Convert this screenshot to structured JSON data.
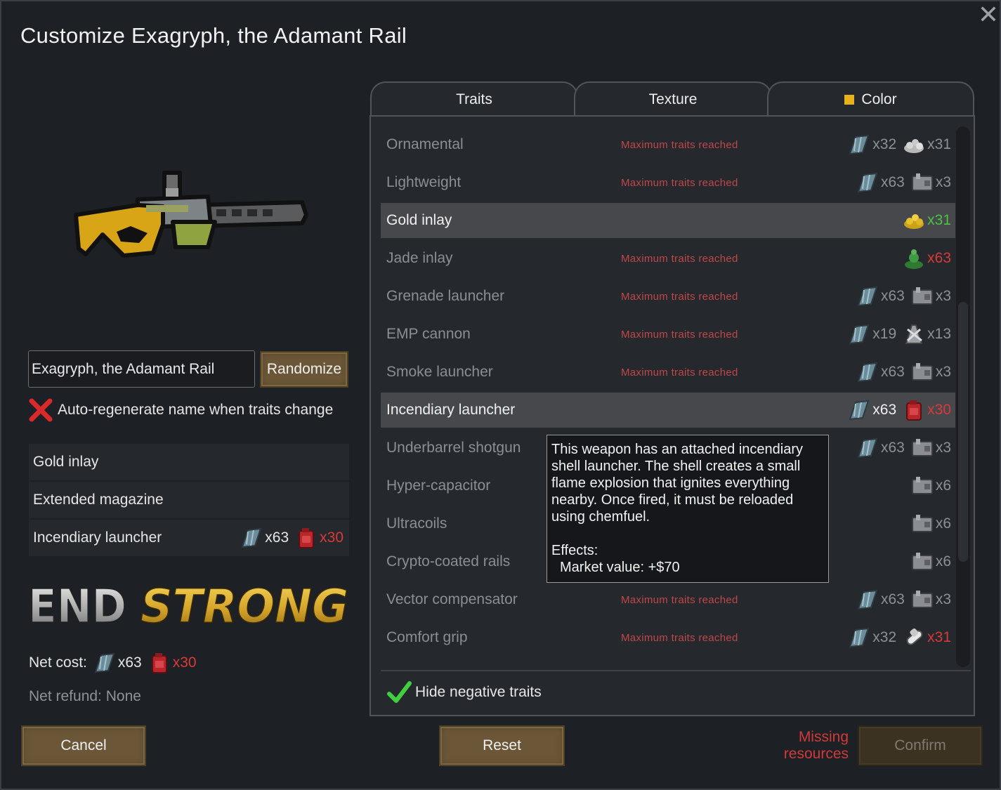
{
  "dialog": {
    "title": "Customize Exagryph, the Adamant Rail",
    "close_icon": "close-icon"
  },
  "name_field": {
    "value": "Exagryph, the Adamant Rail"
  },
  "buttons": {
    "randomize": "Randomize",
    "cancel": "Cancel",
    "reset": "Reset",
    "confirm": "Confirm"
  },
  "autoregen": {
    "label": "Auto-regenerate name when traits change",
    "checked": false
  },
  "selected_traits": [
    {
      "name": "Gold inlay"
    },
    {
      "name": "Extended magazine"
    },
    {
      "name": "Incendiary launcher",
      "cost1": "x63",
      "cost2": "x30"
    }
  ],
  "logo_text": "END STRONG",
  "net_cost": {
    "label": "Net cost:",
    "cost1": "x63",
    "cost2": "x30"
  },
  "net_refund": "Net refund: None",
  "missing": {
    "line1": "Missing",
    "line2": "resources"
  },
  "tabs": [
    {
      "label": "Traits"
    },
    {
      "label": "Texture"
    },
    {
      "label": "Color"
    }
  ],
  "colors": {
    "selected_color": "#e7b21a",
    "error_red": "#d83a3a",
    "ok_green": "#49c34a"
  },
  "traits": [
    {
      "name": "Ornamental",
      "msg": "Maximum traits reached",
      "c1": "x32",
      "c1_icon": "steel-icon",
      "c2": "x31",
      "c2_icon": "silver-icon"
    },
    {
      "name": "Lightweight",
      "msg": "Maximum traits reached",
      "c1": "x63",
      "c1_icon": "steel-icon",
      "c2": "x3",
      "c2_icon": "component-icon"
    },
    {
      "name": "Gold inlay",
      "msg": "",
      "c1": "",
      "c2": "x31",
      "c2_icon": "gold-icon"
    },
    {
      "name": "Jade inlay",
      "msg": "Maximum traits reached",
      "c1": "",
      "c2": "x63",
      "c2_icon": "jade-icon"
    },
    {
      "name": "Grenade launcher",
      "msg": "Maximum traits reached",
      "c1": "x63",
      "c1_icon": "steel-icon",
      "c2": "x3",
      "c2_icon": "component-icon"
    },
    {
      "name": "EMP cannon",
      "msg": "Maximum traits reached",
      "c1": "x19",
      "c1_icon": "steel-icon",
      "c2": "x13",
      "c2_icon": "plasteel-icon"
    },
    {
      "name": "Smoke launcher",
      "msg": "Maximum traits reached",
      "c1": "x63",
      "c1_icon": "steel-icon",
      "c2": "x3",
      "c2_icon": "component-icon"
    },
    {
      "name": "Incendiary launcher",
      "msg": "",
      "c1": "x63",
      "c1_icon": "steel-icon",
      "c2": "x30",
      "c2_icon": "chemfuel-icon"
    },
    {
      "name": "Underbarrel shotgun",
      "msg": "",
      "c1": "x63",
      "c1_icon": "steel-icon",
      "c2": "x3",
      "c2_icon": "component-icon"
    },
    {
      "name": "Hyper-capacitor",
      "msg": "",
      "c1": "",
      "c2": "x6",
      "c2_icon": "component-icon"
    },
    {
      "name": "Ultracoils",
      "msg": "",
      "c1": "",
      "c2": "x6",
      "c2_icon": "component-icon"
    },
    {
      "name": "Crypto-coated rails",
      "msg": "",
      "c1": "",
      "c2": "x6",
      "c2_icon": "component-icon"
    },
    {
      "name": "Vector compensator",
      "msg": "Maximum traits reached",
      "c1": "x63",
      "c1_icon": "steel-icon",
      "c2": "x3",
      "c2_icon": "component-icon"
    },
    {
      "name": "Comfort grip",
      "msg": "Maximum traits reached",
      "c1": "x32",
      "c1_icon": "steel-icon",
      "c2": "x31",
      "c2_icon": "medicine-icon"
    }
  ],
  "tooltip": {
    "description": "This weapon has an attached incendiary shell launcher. The shell creates a small flame explosion that ignites everything nearby. Once fired, it must be reloaded using chemfuel.",
    "effects_label": "Effects:",
    "effect_1": "Market value: +$70"
  },
  "hide_negative": {
    "label": "Hide negative traits",
    "checked": true
  }
}
